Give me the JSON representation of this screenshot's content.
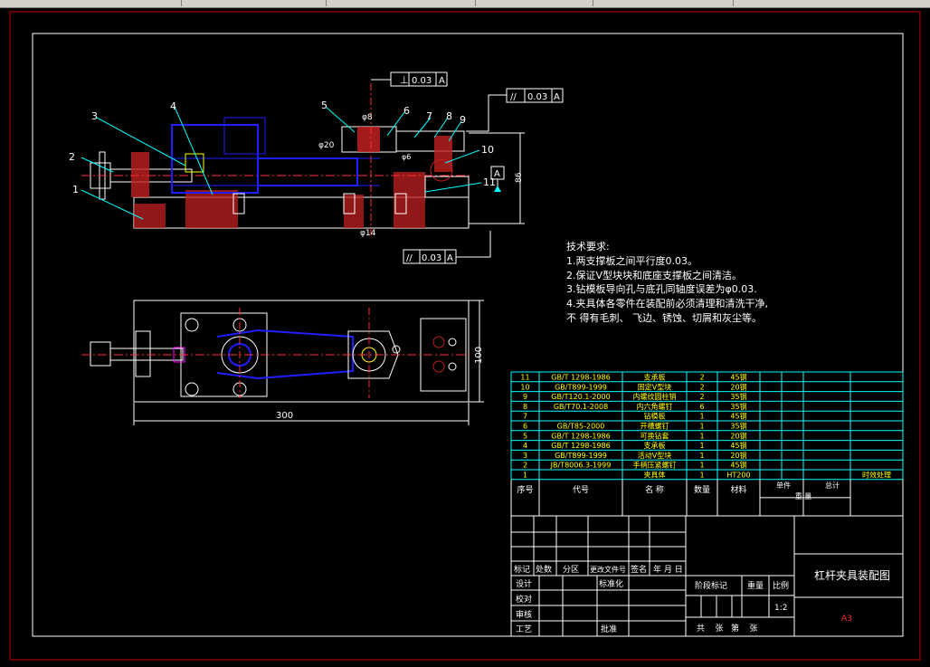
{
  "window": {
    "toolbar_segments": 5
  },
  "dimensions": {
    "flatness_top": "0.03",
    "datum_ref": "A",
    "parallel_top": "0.03",
    "parallel_bottom": "0.03",
    "d8": "φ8",
    "d20": "φ20",
    "d6": "φ6",
    "d14": "φ14",
    "h86": "86",
    "w300": "300",
    "h100": "100"
  },
  "balloons": [
    "1",
    "2",
    "3",
    "4",
    "5",
    "6",
    "7",
    "8",
    "9",
    "10",
    "11"
  ],
  "notes": {
    "title": "技术要求:",
    "lines": [
      "1.两支撑板之间平行度0.03。",
      "2.保证V型块块和底座支撑板之间清洁。",
      "3.钻模板导向孔与底孔同轴度误差为φ0.03.",
      "4.夹具体各零件在装配前必须清理和清洗干净,",
      "不 得有毛刺、 飞边、锈蚀、切屑和灰尘等。"
    ]
  },
  "bom": {
    "rows": [
      {
        "no": "11",
        "code": "GB/T 1298-1986",
        "name": "支承板",
        "qty": "2",
        "mat": "45钢",
        "note": ""
      },
      {
        "no": "10",
        "code": "GB/T899-1999",
        "name": "固定V型块",
        "qty": "2",
        "mat": "20钢",
        "note": ""
      },
      {
        "no": "9",
        "code": "GB/T120.1-2000",
        "name": "内螺纹圆柱销",
        "qty": "2",
        "mat": "35钢",
        "note": ""
      },
      {
        "no": "8",
        "code": "GB/T70.1-2008",
        "name": "内六角螺钉",
        "qty": "6",
        "mat": "35钢",
        "note": ""
      },
      {
        "no": "7",
        "code": "",
        "name": "钻模板",
        "qty": "1",
        "mat": "45钢",
        "note": ""
      },
      {
        "no": "6",
        "code": "GB/T85-2000",
        "name": "开槽螺钉",
        "qty": "1",
        "mat": "35钢",
        "note": ""
      },
      {
        "no": "5",
        "code": "GB/T 1298-1986",
        "name": "可换钻套",
        "qty": "1",
        "mat": "20钢",
        "note": ""
      },
      {
        "no": "4",
        "code": "GB/T 1298-1986",
        "name": "支承板",
        "qty": "1",
        "mat": "45钢",
        "note": ""
      },
      {
        "no": "3",
        "code": "GB/T899-1999",
        "name": "活动V型块",
        "qty": "1",
        "mat": "20钢",
        "note": ""
      },
      {
        "no": "2",
        "code": "JB/T8006.3-1999",
        "name": "手柄压紧螺钉",
        "qty": "1",
        "mat": "45钢",
        "note": ""
      },
      {
        "no": "1",
        "code": "",
        "name": "夹具体",
        "qty": "1",
        "mat": "HT200",
        "note": "时效处理"
      }
    ],
    "header": {
      "no": "序号",
      "code": "代号",
      "name": "名  称",
      "qty": "数量",
      "mat": "材料",
      "unit": "单件",
      "total": "总计",
      "weight": "重   量"
    }
  },
  "titleblock": {
    "mark": "标记",
    "count": "处数",
    "zone": "分区",
    "docno": "更改文件号",
    "sign": "签名",
    "date": "年 月 日",
    "design": "设计",
    "std": "标准化",
    "check": "校对",
    "review": "审核",
    "craft": "工艺",
    "approve": "批准",
    "stage": "阶段标记",
    "weight": "重量",
    "scale": "比例",
    "scale_val": "1:2",
    "sheets": "共    张   第    张",
    "title": "杠杆夹具装配图",
    "size": "A3"
  },
  "colors": {
    "line": "#ffffff",
    "cyan": "#00ffff",
    "red": "#ff3030",
    "blue": "#1e1eff",
    "magenta": "#ff00ff",
    "yellow": "#ffff00",
    "frame": "#c00000"
  }
}
